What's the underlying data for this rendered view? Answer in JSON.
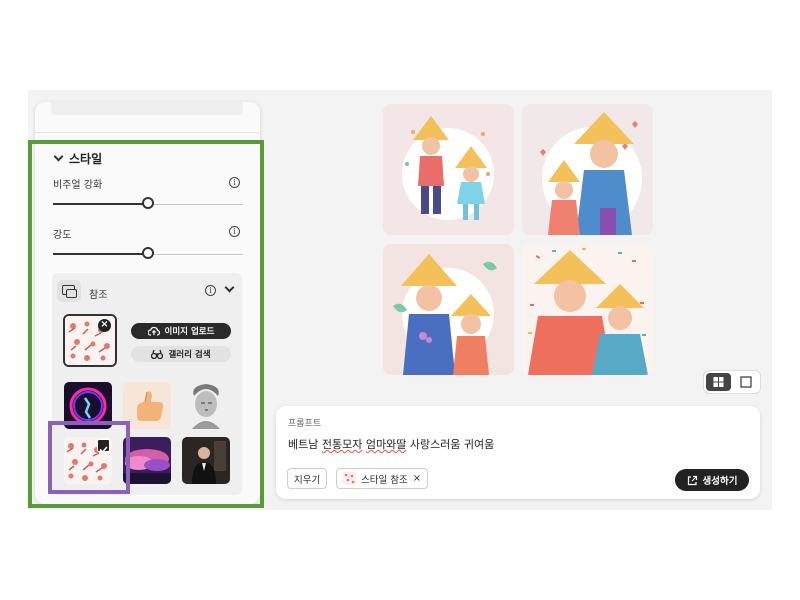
{
  "style_panel": {
    "section_title": "스타일",
    "visual_intensity_label": "비주얼 강화",
    "visual_intensity_value": 0.5,
    "strength_label": "강도",
    "strength_value": 0.5,
    "reference": {
      "label": "참조",
      "upload_button": "이미지 업로드",
      "gallery_button": "갤러리 검색"
    }
  },
  "prompt": {
    "label": "프롬프트",
    "text_before": "베트남 ",
    "text_squiggle1": "전통모자",
    "text_mid": " ",
    "text_squiggle2": "엄마와딸",
    "text_after": " 사랑스러움 귀여움",
    "clear_button": "지우기",
    "style_chip": "스타일 참조",
    "chip_close": "×",
    "generate_button": "생성하기"
  },
  "colors": {
    "highlight_panel": "#5a9a3a",
    "highlight_selected": "#8a62b8",
    "button_dark": "#2a2a2a"
  },
  "icons": {
    "info": "info-icon",
    "chevron": "chevron-down-icon",
    "upload": "cloud-upload-icon",
    "gallery": "binoculars-icon",
    "remove": "close-circle-icon",
    "check": "checkbox-checked-icon",
    "generate": "open-in-new-icon",
    "grid_view": "grid-view-icon",
    "single_view": "single-view-icon"
  }
}
